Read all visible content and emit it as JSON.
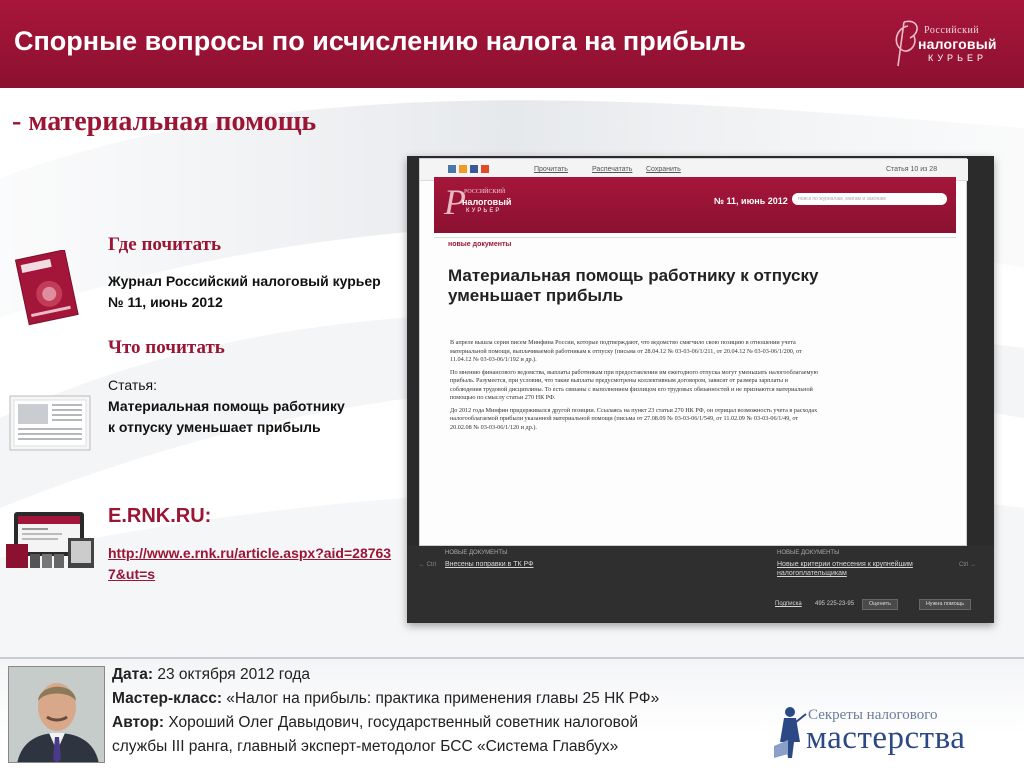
{
  "header": {
    "title": "Спорные вопросы по исчислению налога на прибыль",
    "logo": {
      "line1": "Российский",
      "line2": "налоговый",
      "line3": "КУРЬЕР",
      "colors": {
        "bar": "#9b1535"
      }
    }
  },
  "subtitle": "- материальная помощь",
  "where_to_read": {
    "heading": "Где почитать",
    "line1": "Журнал Российский налоговый курьер",
    "line2": "№ 11, июнь 2012",
    "icon": "magazine-cover-icon"
  },
  "what_to_read": {
    "heading": "Что почитать",
    "label": "Статья:",
    "line1": "Материальная помощь работнику",
    "line2": "к отпуску уменьшает прибыль",
    "icon": "newspaper-icon"
  },
  "site": {
    "heading": "E.RNK.RU:",
    "link": "http://www.e.rnk.ru/article.aspx?aid=287637&ut=s",
    "icon": "devices-icon"
  },
  "screenshot": {
    "toolbar": {
      "print": "Прочитать",
      "printout": "Распечатать",
      "save": "Сохранить",
      "article_counter": "Статья 10 из 28"
    },
    "banner": {
      "logo_line1": "РОССИЙСКИЙ",
      "logo_line2": "налоговый",
      "logo_line3": "КУРЬЕР",
      "issue": "№ 11, июнь 2012",
      "search_placeholder": "поиск по журналам, книгам и законам"
    },
    "section": "новые документы",
    "article_title": "Материальная помощь работнику к отпуску уменьшает прибыль",
    "paragraphs": [
      "В апреле вышла серия писем Минфина России, которые подтверждают, что ведомство смягчило свою позицию в отношении учета материальной помощи, выплачиваемой работникам к отпуску (письма от 28.04.12 № 03-03-06/1/211, от 20.04.12 № 03-03-06/1/200, от 11.04.12 № 03-03-06/1/192 и др.).",
      "По мнению финансового ведомства, выплаты работникам при предоставлении им ежегодного отпуска могут уменьшать налогооблагаемую прибыль. Разумеется, при условии, что такие выплаты предусмотрены коллективным договором, зависят от размера зарплаты и соблюдения трудовой дисциплины. То есть связаны с выполнением физлицом его трудовых обязанностей и не признаются материальной помощью по смыслу статьи 270 НК РФ.",
      "До 2012 года Минфин придерживался другой позиции. Ссылаясь на пункт 23 статьи 270 НК РФ, он отрицал возможность учета в расходах налогооблагаемой прибыли указанной материальной помощи (письма от 27.08.09 № 03-03-06/1/549, от 11.02.09 № 03-03-06/1/49, от 20.02.08 № 03-03-06/1/120 и др.)."
    ],
    "footer": {
      "left_label": "НОВЫЕ ДОКУМЕНТЫ",
      "left_link": "Внесены поправки в ТК РФ",
      "left_arrow": "← Ctrl",
      "right_label": "НОВЫЕ ДОКУМЕНТЫ",
      "right_link_1": "Новые критерии отнесения к крупнейшим",
      "right_link_2": "налогоплательщикам",
      "right_arrow": "Ctrl →",
      "subscribe": "Подписка",
      "phone": "495 225-23-95",
      "rate_btn": "Оценить",
      "help_btn": "Нужна помощь"
    }
  },
  "bottom": {
    "date_label": "Дата:",
    "date_value": " 23 октября 2012 года",
    "master_label": "Мастер-класс:",
    "master_value": " «Налог на прибыль: практика применения главы 25 НК РФ»",
    "author_label": "Автор:",
    "author_value": " Хороший Олег Давыдович, государственный советник налоговой",
    "author_value_2": "службы III ранга, главный эксперт-методолог БСС «Система Главбух»",
    "logo_small": "Секреты налогового",
    "logo_big": "мастерства"
  },
  "colors": {
    "accent": "#9b1535",
    "logo_blue": "#2b4a85"
  }
}
